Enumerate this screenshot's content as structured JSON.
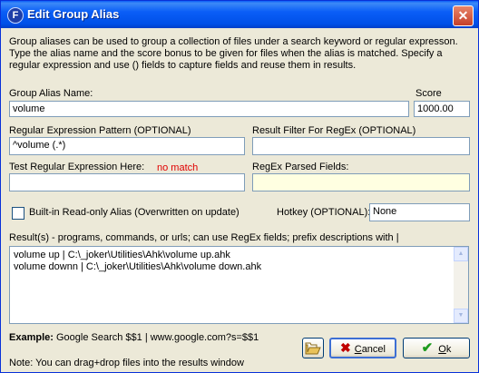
{
  "window": {
    "title": "Edit Group Alias",
    "app_icon": "F",
    "close_icon": "✕"
  },
  "description": "Group aliases can be used to group a collection of files under a search keyword or regular expresson. Type the alias name and the score bonus to be given for files when the alias is matched. Specify a regular expression and use () fields to capture fields and reuse them in results.",
  "alias_name": {
    "label": "Group Alias Name:",
    "value": "volume"
  },
  "score": {
    "label": "Score",
    "value": "1000.00"
  },
  "regex_pattern": {
    "label": "Regular Expression Pattern (OPTIONAL)",
    "value": "^volume (.*)"
  },
  "result_filter": {
    "label": "Result Filter For RegEx (OPTIONAL)",
    "value": ""
  },
  "test_regex": {
    "label": "Test Regular Expression Here:",
    "value": "",
    "status": "no match"
  },
  "parsed_fields": {
    "label": "RegEx Parsed Fields:",
    "value": ""
  },
  "builtin_checkbox": {
    "label": "Built-in Read-only Alias (Overwritten on update)",
    "checked": false
  },
  "hotkey": {
    "label": "Hotkey (OPTIONAL):",
    "value": "None"
  },
  "results": {
    "label": "Result(s) - programs, commands, or urls; can use RegEx fields; prefix descriptions with |",
    "lines": [
      "volume up | C:\\_joker\\Utilities\\Ahk\\volume up.ahk",
      "volume downn | C:\\_joker\\Utilities\\Ahk\\volume down.ahk"
    ]
  },
  "example": {
    "label": "Example:",
    "text": "Google Search $$1 | www.google.com?s=$$1"
  },
  "note": "Note: You can drag+drop files into the results window",
  "buttons": {
    "cancel_prefix": "",
    "cancel_underlined": "C",
    "cancel_rest": "ancel",
    "ok_underlined": "O",
    "ok_rest": "k"
  },
  "colors": {
    "title_bar": "#0a5ef7",
    "error_text": "#e00000",
    "parsed_bg": "#ffffe1"
  }
}
